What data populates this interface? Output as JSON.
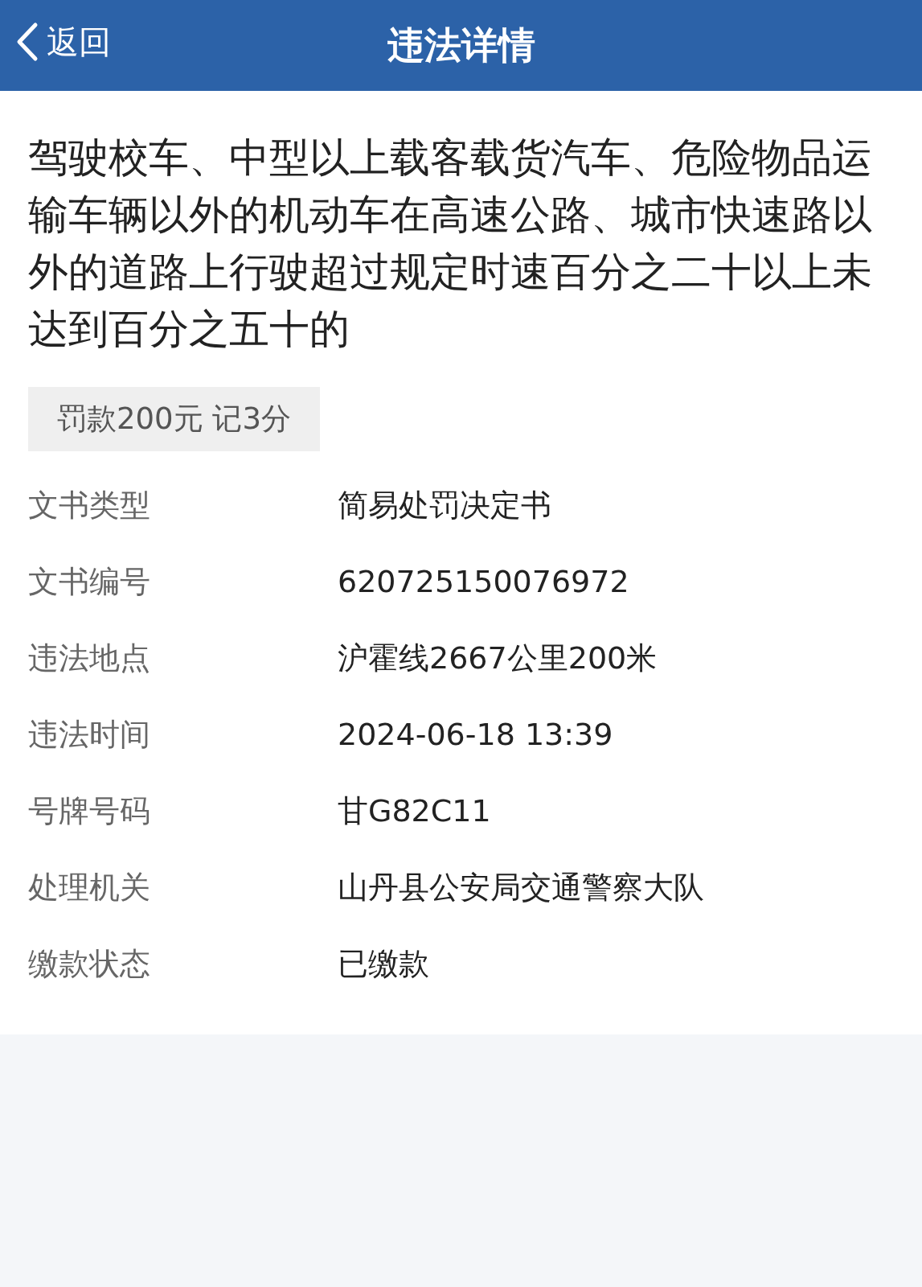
{
  "header": {
    "back_label": "返回",
    "title": "违法详情"
  },
  "violation": {
    "description": "驾驶校车、中型以上载客载货汽车、危险物品运输车辆以外的机动车在高速公路、城市快速路以外的道路上行驶超过规定时速百分之二十以上未达到百分之五十的",
    "penalty": "罚款200元 记3分"
  },
  "details": [
    {
      "label": "文书类型",
      "value": "简易处罚决定书"
    },
    {
      "label": "文书编号",
      "value": "620725150076972"
    },
    {
      "label": "违法地点",
      "value": "沪霍线2667公里200米"
    },
    {
      "label": "违法时间",
      "value": "2024-06-18 13:39"
    },
    {
      "label": "号牌号码",
      "value": "甘G82C11"
    },
    {
      "label": "处理机关",
      "value": "山丹县公安局交通警察大队"
    },
    {
      "label": "缴款状态",
      "value": "已缴款"
    }
  ]
}
